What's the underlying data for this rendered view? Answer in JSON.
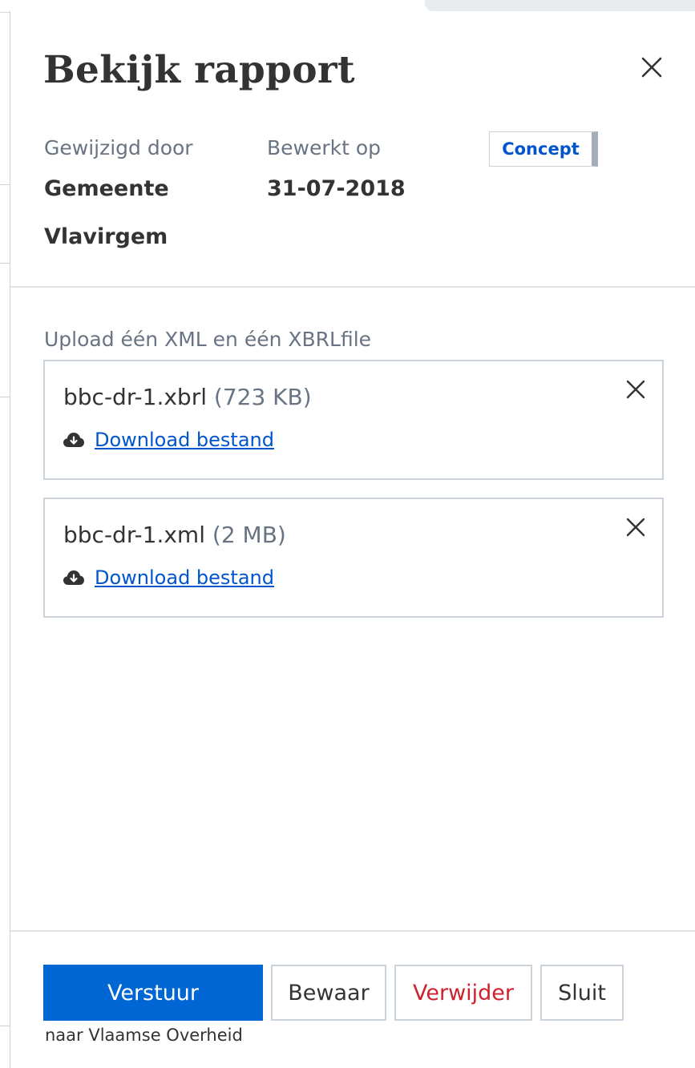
{
  "header": {
    "title": "Bekijk rapport",
    "close_icon": "close-icon"
  },
  "meta": {
    "modified_by_label": "Gewijzigd door",
    "modified_by_line1": "Gemeente",
    "modified_by_line2": "Vlavirgem",
    "edited_on_label": "Bewerkt op",
    "edited_on_value": "31-07-2018",
    "status_badge": "Concept"
  },
  "upload": {
    "label": "Upload één XML en één XBRLfile",
    "files": [
      {
        "name": "bbc-dr-1.xbrl",
        "size": "(723 KB)",
        "download_label": "Download bestand"
      },
      {
        "name": "bbc-dr-1.xml",
        "size": "(2 MB)",
        "download_label": "Download bestand"
      }
    ]
  },
  "footer": {
    "send_label": "Verstuur",
    "send_sublabel": "naar Vlaamse Overheid",
    "save_label": "Bewaar",
    "delete_label": "Verwijder",
    "close_label": "Sluit"
  },
  "colors": {
    "primary": "#0066d3",
    "link": "#0055cc",
    "danger": "#d0202d",
    "muted_text": "#687483",
    "border": "#cbd2da"
  }
}
